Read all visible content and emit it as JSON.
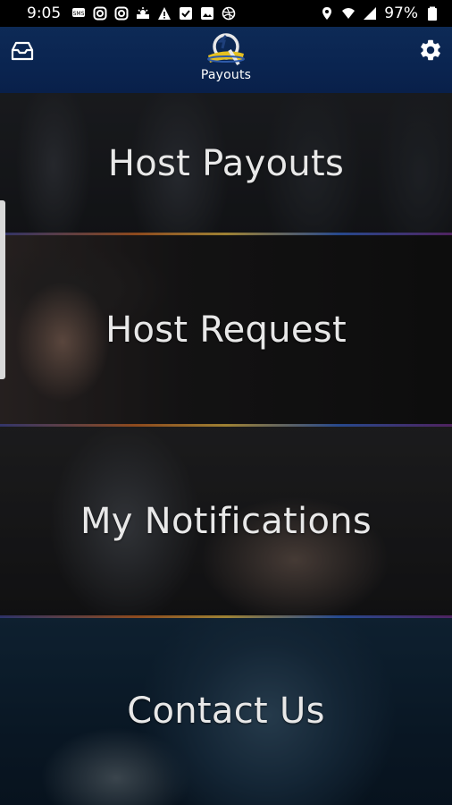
{
  "status_bar": {
    "time": "9:05",
    "battery": "97%",
    "left_icons": [
      "sms-icon",
      "instagram-icon",
      "instagram-icon",
      "weather-icon",
      "alert-icon",
      "checkbox-icon",
      "gallery-icon",
      "dribbble-icon"
    ],
    "right_icons": [
      "location-icon",
      "wifi-icon",
      "signal-icon",
      "battery-icon"
    ]
  },
  "app_bar": {
    "logo_text": "Payouts",
    "inbox_icon": "inbox-icon",
    "settings_icon": "gear-icon",
    "background": "#0a2450"
  },
  "menu": {
    "items": [
      {
        "label": "Host Payouts"
      },
      {
        "label": "Host Request"
      },
      {
        "label": "My Notifications"
      },
      {
        "label": "Contact Us"
      }
    ]
  }
}
